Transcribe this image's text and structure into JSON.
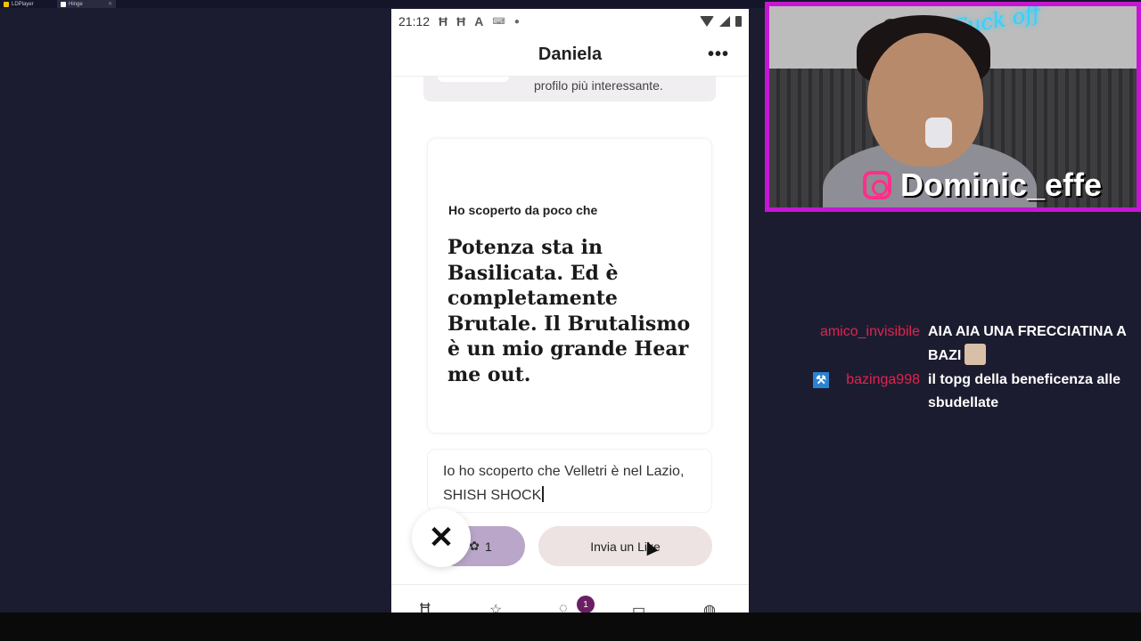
{
  "host_tabs": [
    {
      "label": "LDPlayer"
    },
    {
      "label": "Hinge"
    }
  ],
  "phone": {
    "status": {
      "time": "21:12",
      "icons": [
        "hinge-notification-icon",
        "hinge-notification-icon",
        "font-icon",
        "keyboard-icon",
        "dot-icon"
      ],
      "right_icons": [
        "wifi-icon",
        "cell-signal-icon",
        "battery-icon"
      ]
    },
    "header": {
      "title": "Daniela",
      "more_icon": "more-dots-icon"
    },
    "previous_card_text": "profilo più interessante.",
    "prompt": {
      "question": "Ho scoperto da poco che",
      "answer": "Potenza sta in Basilicata. Ed è completamente Brutale. Il Brutalismo è un mio grande Hear me out."
    },
    "comment": {
      "value": "Io ho scoperto che Velletri è nel Lazio, SHISH SHOCK"
    },
    "rose_button": {
      "count": "1",
      "icon": "rose-icon"
    },
    "like_button": {
      "label": "Invia un Like"
    },
    "close_button_icon": "close-icon",
    "nav": {
      "items": [
        "hinge-home-icon",
        "star-icon",
        "chat-icon",
        "matches-icon",
        "profile-avatar-icon"
      ],
      "badge_count": "1"
    },
    "colors": {
      "rose_button": "#b9a6c8",
      "like_button": "#ede3e3",
      "badge": "#6a1f63"
    }
  },
  "webcam": {
    "neon_sign": "Fuck off",
    "handle": "Dominic_effe",
    "border_color": "#c516d4",
    "social_icon": "instagram-icon"
  },
  "chat": [
    {
      "user": "amico_invisibile",
      "text": "AIA AIA UNA FRECCIATINA A BAZI",
      "emote": "face-emote-icon"
    },
    {
      "user": "bazinga998",
      "text": "il topg della beneficenza alle sbudellate",
      "badge_icon": "hammer-badge-icon"
    }
  ],
  "colors": {
    "background": "#1c1c30",
    "username": "#e0244f"
  }
}
